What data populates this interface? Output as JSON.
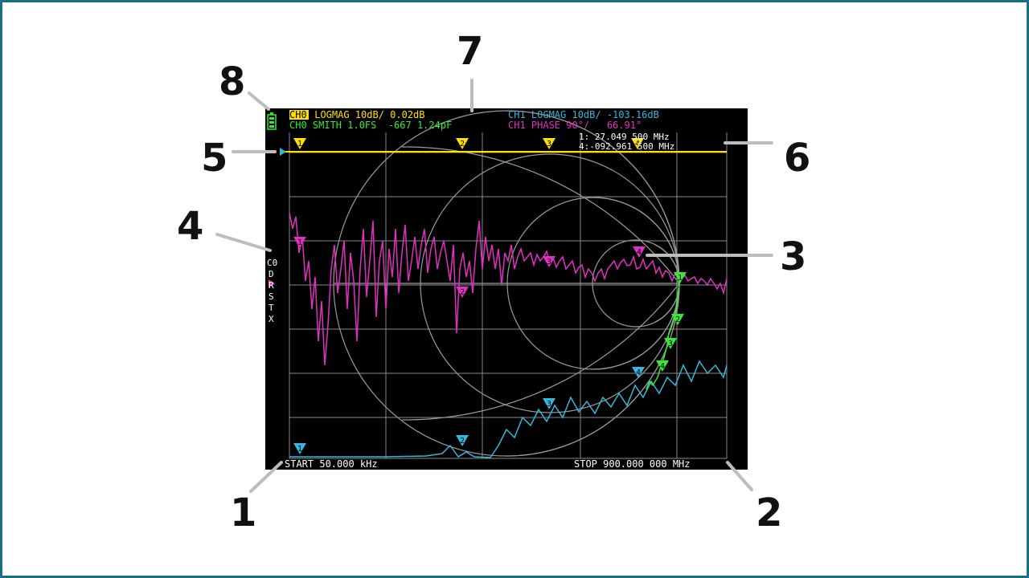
{
  "colors": {
    "frame": "#1a6f80",
    "screen_bg": "#000000",
    "ch0_yellow": "#ffe000",
    "ch0_green": "#38e838",
    "ch1_cyan": "#33b8dd",
    "ch1_magenta": "#e030c0",
    "grid": "#8a8a8a",
    "smith": "#9a9a9a",
    "text_white": "#ffffff"
  },
  "status": {
    "ch0_logmag_tag": "CH0",
    "ch0_logmag_text": " LOGMAG 10dB/ 0.02dB",
    "ch0_smith_text": "CH0 SMITH 1.0FS  -667 1.24pF",
    "ch1_logmag_text": "CH1 LOGMAG 10dB/ -103.16dB",
    "ch1_phase_text": "CH1 PHASE 90°/   66.91°",
    "marker_freq_line1": "1: 27.049 500 MHz",
    "marker_freq_line2": "4:-092.961 500 MHz",
    "start_freq": "START 50.000 kHz",
    "stop_freq": "STOP 900.000 000 MHz",
    "cal_status": [
      "C0",
      "D",
      "R",
      "S",
      "T",
      "X"
    ]
  },
  "callouts": {
    "c1": "1",
    "c2": "2",
    "c3": "3",
    "c4": "4",
    "c5": "5",
    "c6": "6",
    "c7": "7",
    "c8": "8"
  },
  "markers": {
    "yellow": [
      "1",
      "2",
      "3",
      "4"
    ],
    "magenta": [
      "1",
      "2",
      "3",
      "4"
    ],
    "cyan": [
      "1",
      "2",
      "3",
      "4"
    ],
    "green": [
      "1",
      "2",
      "3",
      "4"
    ]
  },
  "icons": {
    "battery": "battery-icon",
    "ref_marker": "reference-arrow-icon"
  }
}
